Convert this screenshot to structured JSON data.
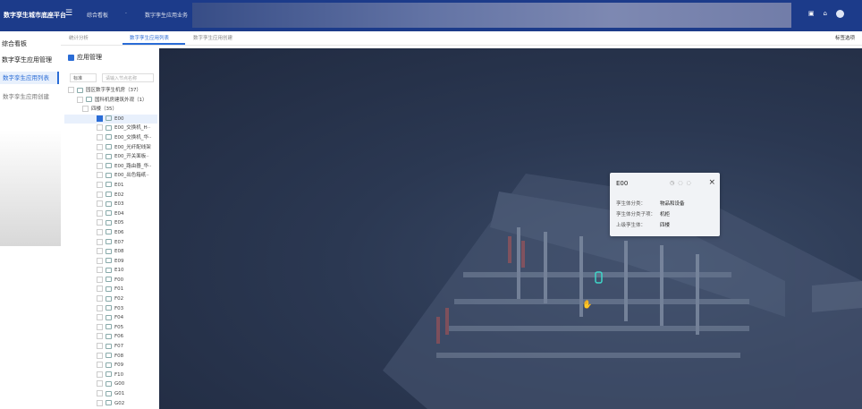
{
  "header": {
    "brand": "数字孪生城市底座平台",
    "nav": [
      "综合看板",
      "·",
      "数字孪生应用业务"
    ],
    "icons": [
      "tshirt-icon",
      "home-icon",
      "user-avatar"
    ]
  },
  "sidebar": {
    "items": [
      {
        "label": "综合看板"
      },
      {
        "label": "数字孪生应用管理"
      },
      {
        "label": "数字孪生应用列表",
        "active": true
      },
      {
        "label": "数字孪生应用创建"
      }
    ]
  },
  "tabs": {
    "items": [
      "统计分析",
      "数字孪生应用列表",
      "数字孪生应用创建"
    ],
    "active": 1,
    "close_label": "标签选项"
  },
  "panel": {
    "title": "应用管理",
    "select_value": "标准",
    "search_placeholder": "请输入节点名称",
    "tree": [
      "园区数字孪生机房（37）",
      "国科机房建筑外观（1）",
      "四楼（35）",
      "E00",
      "E00_交换机_H··",
      "E00_交换机_华··",
      "E00_光纤配线架",
      "E00_开关面板··",
      "E00_路由器_华··",
      "E00_出色箱纸··",
      "E01",
      "E02",
      "E03",
      "E04",
      "E05",
      "E06",
      "E07",
      "E08",
      "E09",
      "E10",
      "F00",
      "F01",
      "F02",
      "F03",
      "F04",
      "F05",
      "F06",
      "F07",
      "F08",
      "F09",
      "F10",
      "G00",
      "G01",
      "G02"
    ]
  },
  "popup": {
    "title": "E00",
    "rows": [
      {
        "label": "孪生体分类：",
        "value": "物品和设备"
      },
      {
        "label": "孪生体分类子项：",
        "value": "机柜"
      },
      {
        "label": "上级孪生体：",
        "value": "四楼"
      }
    ]
  }
}
